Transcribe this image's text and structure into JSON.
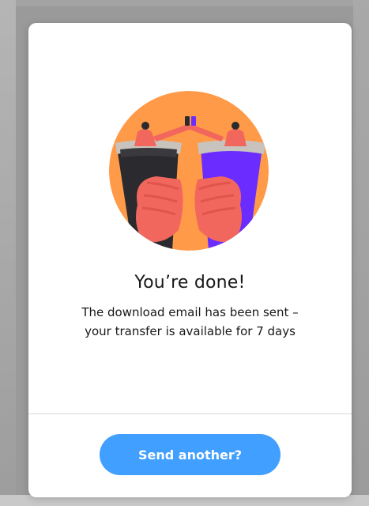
{
  "modal": {
    "title": "You’re done!",
    "message_line1": "The download email has been sent –",
    "message_line2": "your transfer is available for 7 days",
    "primary_button_label": "Send another?"
  },
  "colors": {
    "primary": "#409fff",
    "illustration_bg": "#ff9a48",
    "glass_dark": "#2b2b2f",
    "glass_purple": "#6a2cff",
    "hand": "#f2675d"
  },
  "icons": {
    "illustration": "celebration-illustration"
  }
}
